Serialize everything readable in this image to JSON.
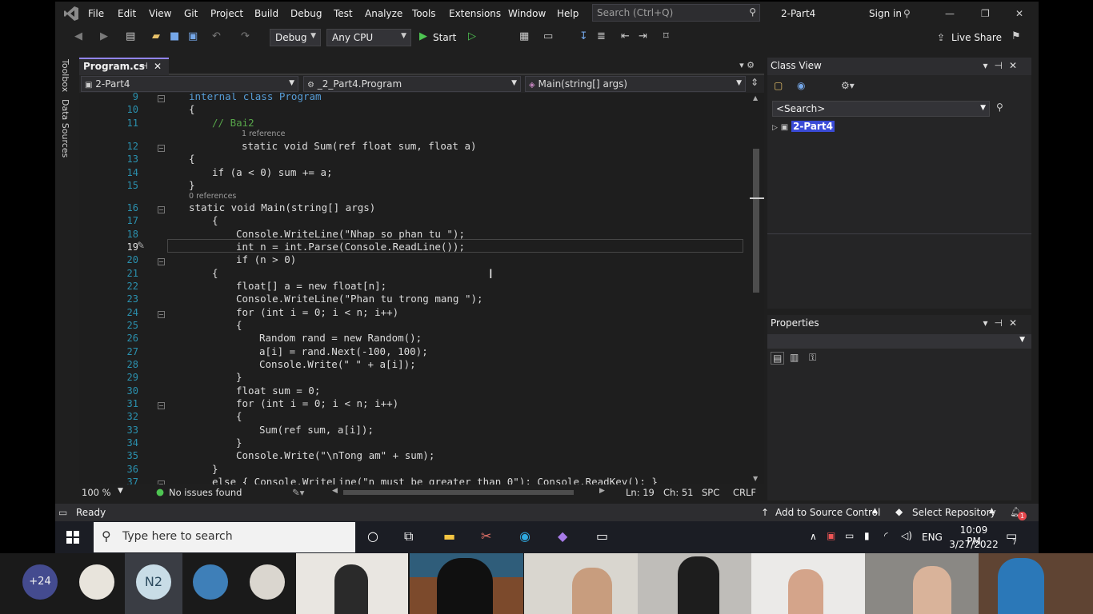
{
  "menu": {
    "items": [
      "File",
      "Edit",
      "View",
      "Git",
      "Project",
      "Build",
      "Debug",
      "Test",
      "Analyze",
      "Tools",
      "Extensions",
      "Window",
      "Help"
    ],
    "search_placeholder": "Search (Ctrl+Q)",
    "solution_name": "2-Part4",
    "sign_in": "Sign in"
  },
  "toolbar": {
    "config": "Debug",
    "platform": "Any CPU",
    "start": "Start",
    "live_share": "Live Share"
  },
  "side_tabs": [
    "Toolbox",
    "Data Sources"
  ],
  "editor": {
    "tab_name": "Program.cs",
    "nav_project": "2-Part4",
    "nav_class": "_2_Part4.Program",
    "nav_member": "Main(string[] args)",
    "zoom": "100 %",
    "issues": "No issues found",
    "line": "Ln: 19",
    "col": "Ch: 51",
    "spc": "SPC",
    "crlf": "CRLF",
    "line_numbers": [
      "9",
      "10",
      "11",
      "12",
      "13",
      "14",
      "15",
      "16",
      "17",
      "18",
      "19",
      "20",
      "21",
      "22",
      "23",
      "24",
      "25",
      "26",
      "27",
      "28",
      "29",
      "30",
      "31",
      "32",
      "33",
      "34",
      "35",
      "36",
      "37"
    ],
    "lens_1": "1 reference",
    "lens_2": "0 references",
    "code": {
      "l9": "internal class Program",
      "l11": "// Bai2",
      "l12": "static void Sum(ref float sum, float a)",
      "l14": "if (a < 0) sum += a;",
      "l16": "static void Main(string[] args)",
      "l18": "Console.WriteLine(\"Nhap so phan tu \");",
      "l19": "int n = int.Parse(Console.ReadLine());",
      "l20": "if (n > 0)",
      "l22": "float[] a = new float[n];",
      "l23": "Console.WriteLine(\"Phan tu trong mang \");",
      "l24": "for (int i = 0; i < n; i++)",
      "l26": "Random rand = new Random();",
      "l27": "a[i] = rand.Next(-100, 100);",
      "l28": "Console.Write(\" \" + a[i]);",
      "l30": "float sum = 0;",
      "l31": "for (int i = 0; i < n; i++)",
      "l33": "Sum(ref sum, a[i]);",
      "l35": "Console.Write(\"\\nTong am\" + sum);",
      "l37": "else { Console.WriteLine(\"n must be greater than 0\"); Console.ReadKey(); }"
    }
  },
  "class_view": {
    "title": "Class View",
    "search": "<Search>",
    "node": "2-Part4"
  },
  "properties": {
    "title": "Properties"
  },
  "status": {
    "ready": "Ready",
    "source_control": "Add to Source Control",
    "repo": "Select Repository",
    "notif_count": "1"
  },
  "taskbar": {
    "search_placeholder": "Type here to search",
    "lang": "ENG",
    "time": "10:09 PM",
    "date": "3/27/2022",
    "notif": "7"
  },
  "meeting": {
    "extra_count": "+24",
    "initials": "N2"
  },
  "colors": {
    "accent": "#9184ee",
    "background": "#1e1e1e",
    "keyword": "#569cd6",
    "type": "#4ec9b0",
    "string": "#d69d85"
  }
}
